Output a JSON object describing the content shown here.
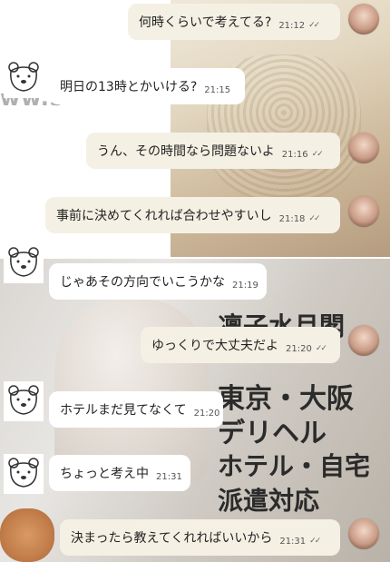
{
  "watermark": "ww.s",
  "overlay": {
    "line1": "凛子水月閣",
    "line2": "東京・大阪",
    "line3": "デリヘル",
    "line4": "ホテル・自宅",
    "line5": "派遣対応"
  },
  "messages": [
    {
      "side": "right",
      "text": "何時くらいで考えてる?",
      "time": "21:12",
      "read": true
    },
    {
      "side": "left",
      "text": "明日の13時とかいける?",
      "time": "21:15"
    },
    {
      "side": "right",
      "text": "うん、その時間なら問題ないよ",
      "time": "21:16",
      "read": true
    },
    {
      "side": "right",
      "text": "事前に決めてくれれば合わせやすいし",
      "time": "21:18",
      "read": true
    },
    {
      "side": "left",
      "text": "じゃあその方向でいこうかな",
      "time": "21:19"
    },
    {
      "side": "right",
      "text": "ゆっくりで大丈夫だよ",
      "time": "21:20",
      "read": true
    },
    {
      "side": "left",
      "text": "ホテルまだ見てなくて",
      "time": "21:20"
    },
    {
      "side": "left",
      "text": "ちょっと考え中",
      "time": "21:31"
    },
    {
      "side": "right",
      "text": "決まったら教えてくれればいいから",
      "time": "21:31",
      "read": true
    }
  ],
  "read_mark": "✓✓",
  "icons": {
    "self_avatar": "profile-photo-avatar",
    "partner_avatar": "bear-sketch-avatar"
  }
}
